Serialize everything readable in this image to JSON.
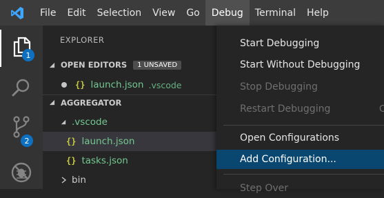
{
  "menubar": {
    "items": [
      "File",
      "Edit",
      "Selection",
      "View",
      "Go",
      "Debug",
      "Terminal",
      "Help"
    ],
    "active": "Debug"
  },
  "activitybar": {
    "explorer_badge": "1",
    "scm_badge": "2"
  },
  "sidebar": {
    "title": "EXPLORER",
    "open_editors": {
      "header": "OPEN EDITORS",
      "badge": "1 UNSAVED",
      "file": "launch.json",
      "file_desc": ".vscode",
      "icon": "{}"
    },
    "folder": {
      "header": "AGGREGATOR",
      "subfolder": ".vscode",
      "files": [
        "launch.json",
        "tasks.json"
      ],
      "collapsed_folder": "bin"
    }
  },
  "debug_menu": {
    "items": [
      {
        "label": "Start Debugging",
        "disabled": false
      },
      {
        "label": "Start Without Debugging",
        "disabled": false
      },
      {
        "label": "Stop Debugging",
        "disabled": true
      },
      {
        "label": "Restart Debugging",
        "disabled": true
      },
      {
        "label": "Open Configurations",
        "disabled": false
      },
      {
        "label": "Add Configuration...",
        "disabled": false,
        "highlighted": true
      },
      {
        "label": "Step Over",
        "disabled": true
      }
    ],
    "restart_shortcut_partial": "C"
  },
  "colors": {
    "accent": "#0e70c0",
    "menu_highlight": "#094771",
    "git_added": "#73c991",
    "json_icon": "#cbcb41"
  }
}
